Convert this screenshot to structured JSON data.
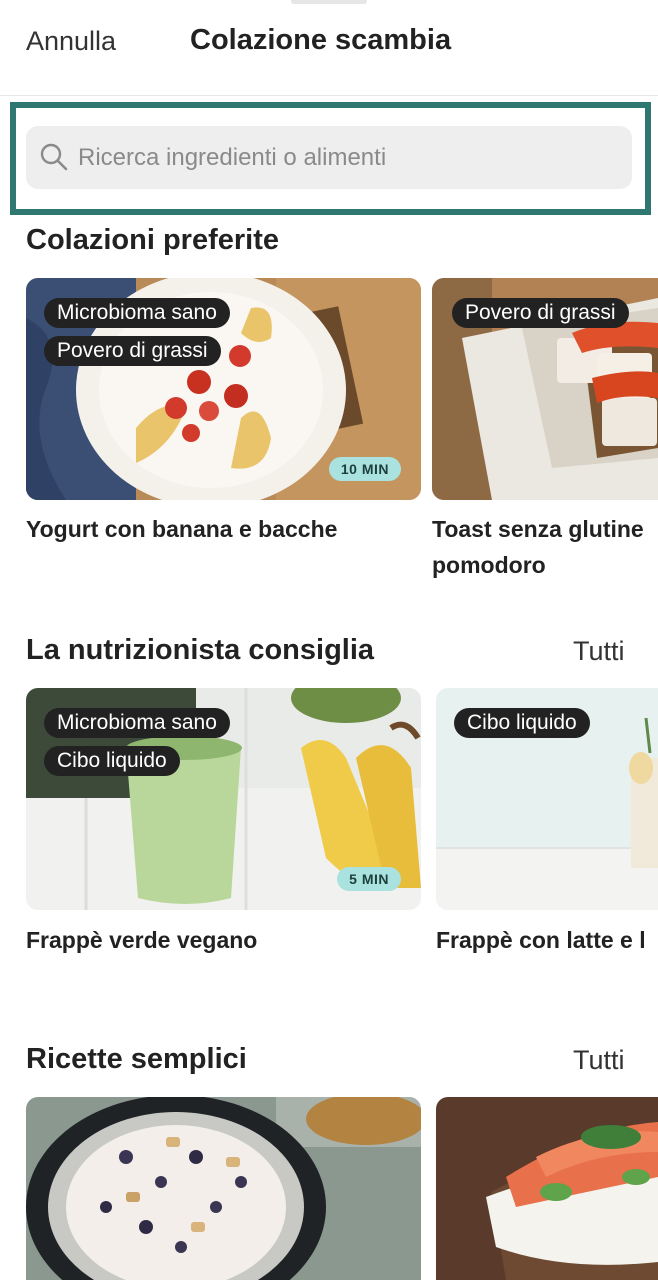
{
  "header": {
    "cancel_label": "Annulla",
    "title": "Colazione scambia"
  },
  "search": {
    "placeholder": "Ricerca ingredienti o alimenti",
    "icon": "search-icon"
  },
  "sections": [
    {
      "title": "Colazioni preferite",
      "see_all": "",
      "cards": [
        {
          "title": "Yogurt con banana e bacche",
          "tags": [
            "Microbioma sano",
            "Povero di grassi"
          ],
          "time": "10 MIN"
        },
        {
          "title_line1": "Toast senza glutine",
          "title_line2": "pomodoro",
          "tags": [
            "Povero di grassi"
          ]
        }
      ]
    },
    {
      "title": "La nutrizionista consiglia",
      "see_all": "Tutti",
      "cards": [
        {
          "title": "Frappè verde vegano",
          "tags": [
            "Microbioma sano",
            "Cibo liquido"
          ],
          "time": "5 MIN"
        },
        {
          "title": "Frappè con latte e l",
          "tags": [
            "Cibo liquido"
          ]
        }
      ]
    },
    {
      "title": "Ricette semplici",
      "see_all": "Tutti",
      "cards": [
        {},
        {}
      ]
    }
  ],
  "colors": {
    "accent_frame": "#2f7771",
    "tag_bg": "#222222",
    "time_badge_bg": "#a9e2de"
  }
}
